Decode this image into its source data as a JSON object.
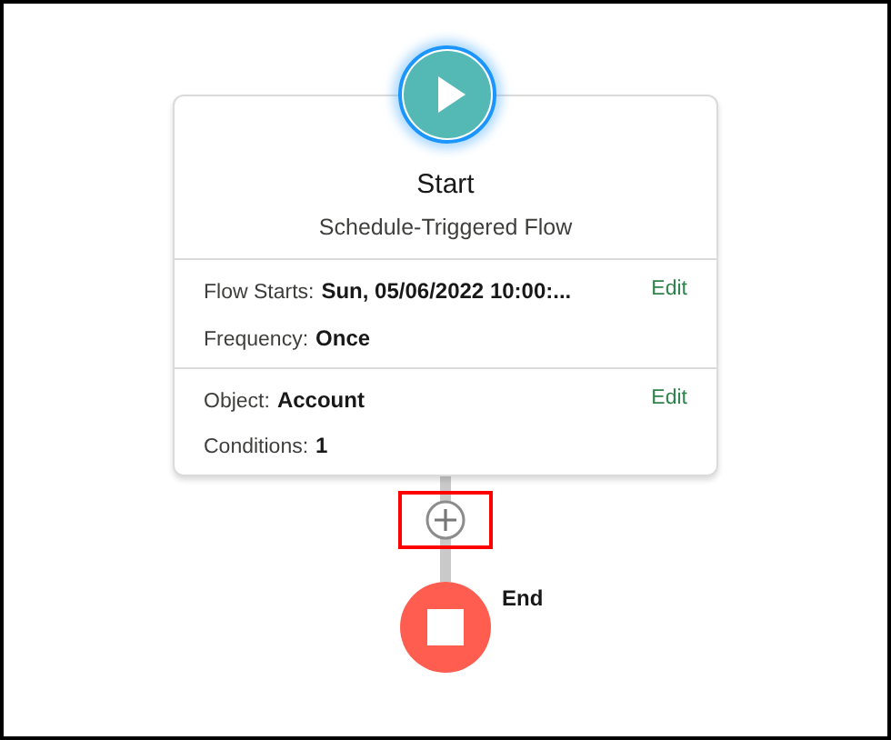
{
  "start": {
    "title": "Start",
    "subtitle": "Schedule-Triggered Flow"
  },
  "sections": [
    {
      "action": "Edit",
      "fields": [
        {
          "label": "Flow Starts:",
          "value": "Sun, 05/06/2022 10:00:..."
        },
        {
          "label": "Frequency:",
          "value": "Once"
        }
      ]
    },
    {
      "action": "Edit",
      "fields": [
        {
          "label": "Object:",
          "value": "Account"
        },
        {
          "label": "Conditions:",
          "value": "1"
        }
      ]
    }
  ],
  "add_button": {
    "highlighted": true
  },
  "end": {
    "label": "End"
  }
}
